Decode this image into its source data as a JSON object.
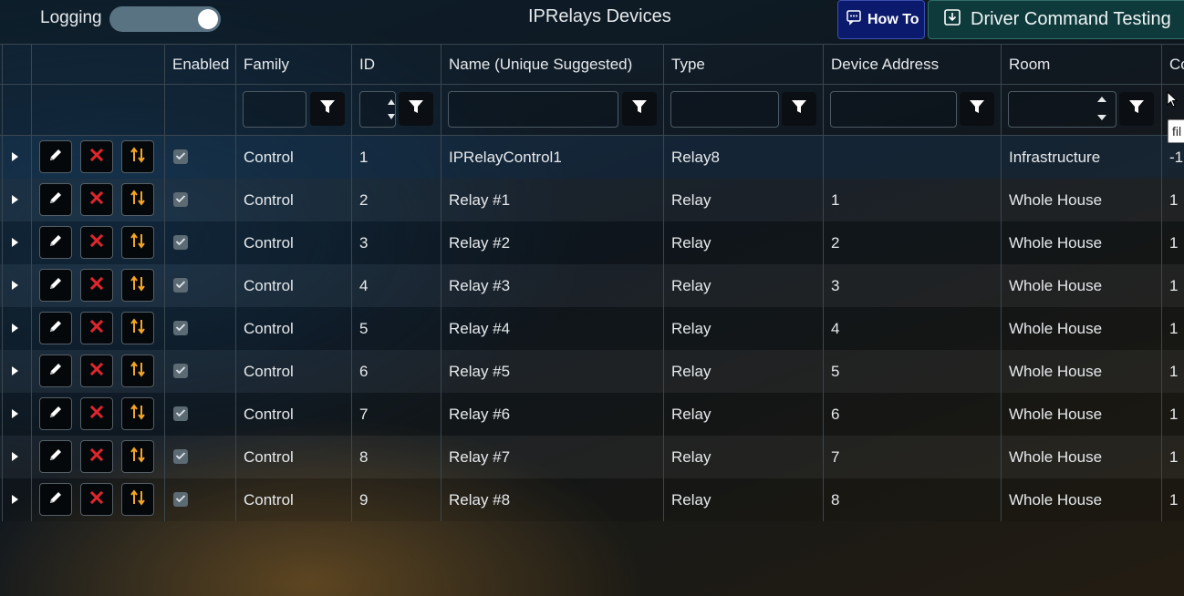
{
  "header": {
    "logging_label": "Logging",
    "logging_on": true,
    "title": "IPRelays Devices",
    "howto_label": "How To",
    "driver_label": "Driver Command Testing"
  },
  "columns": [
    "Enabled",
    "Family",
    "ID",
    "Name (Unique Suggested)",
    "Type",
    "Device Address",
    "Room",
    "Co"
  ],
  "tooltip": "fil",
  "rows": [
    {
      "enabled": true,
      "family": "Control",
      "id": "1",
      "name": "IPRelayControl1",
      "type": "Relay8",
      "address": "",
      "room": "Infrastructure",
      "co": "-1"
    },
    {
      "enabled": true,
      "family": "Control",
      "id": "2",
      "name": "Relay #1",
      "type": "Relay",
      "address": "1",
      "room": "Whole House",
      "co": "1"
    },
    {
      "enabled": true,
      "family": "Control",
      "id": "3",
      "name": "Relay #2",
      "type": "Relay",
      "address": "2",
      "room": "Whole House",
      "co": "1"
    },
    {
      "enabled": true,
      "family": "Control",
      "id": "4",
      "name": "Relay #3",
      "type": "Relay",
      "address": "3",
      "room": "Whole House",
      "co": "1"
    },
    {
      "enabled": true,
      "family": "Control",
      "id": "5",
      "name": "Relay #4",
      "type": "Relay",
      "address": "4",
      "room": "Whole House",
      "co": "1"
    },
    {
      "enabled": true,
      "family": "Control",
      "id": "6",
      "name": "Relay #5",
      "type": "Relay",
      "address": "5",
      "room": "Whole House",
      "co": "1"
    },
    {
      "enabled": true,
      "family": "Control",
      "id": "7",
      "name": "Relay #6",
      "type": "Relay",
      "address": "6",
      "room": "Whole House",
      "co": "1"
    },
    {
      "enabled": true,
      "family": "Control",
      "id": "8",
      "name": "Relay #7",
      "type": "Relay",
      "address": "7",
      "room": "Whole House",
      "co": "1"
    },
    {
      "enabled": true,
      "family": "Control",
      "id": "9",
      "name": "Relay #8",
      "type": "Relay",
      "address": "8",
      "room": "Whole House",
      "co": "1"
    }
  ],
  "colors": {
    "edit_icon": "#ffffff",
    "delete_icon": "#e0262b",
    "move_icon": "#f5a524",
    "howto_bg": "#0c1a6e",
    "driver_bg": "#0e3a3c",
    "toggle_track": "#5a7382"
  }
}
